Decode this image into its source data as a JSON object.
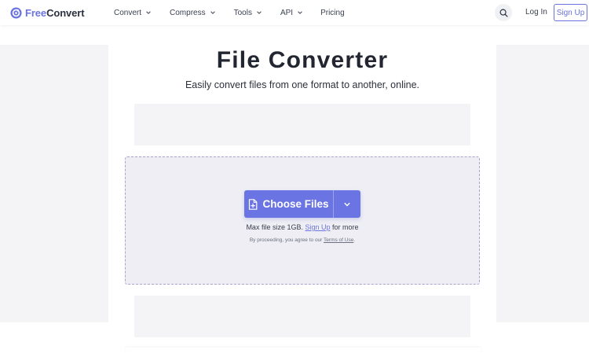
{
  "brand": {
    "name_part1": "Free",
    "name_part2": "Convert",
    "accent_color": "#6a74df"
  },
  "nav": {
    "items": [
      {
        "label": "Convert",
        "has_dropdown": true
      },
      {
        "label": "Compress",
        "has_dropdown": true
      },
      {
        "label": "Tools",
        "has_dropdown": true
      },
      {
        "label": "API",
        "has_dropdown": true
      },
      {
        "label": "Pricing",
        "has_dropdown": false
      }
    ],
    "search_icon": "search-icon",
    "login_label": "Log In",
    "signup_label": "Sign Up"
  },
  "hero": {
    "title": "File Converter",
    "subtitle": "Easily convert files from one format to another, online."
  },
  "uploader": {
    "choose_label": "Choose Files",
    "choose_icon": "file-plus-icon",
    "dropdown_icon": "chevron-down-icon",
    "max_text_before": "Max file size 1GB.",
    "max_link": "Sign Up",
    "max_text_after": "for more",
    "terms_before": "By proceeding, you agree to our",
    "terms_link": "Terms of Use",
    "terms_after": "."
  }
}
